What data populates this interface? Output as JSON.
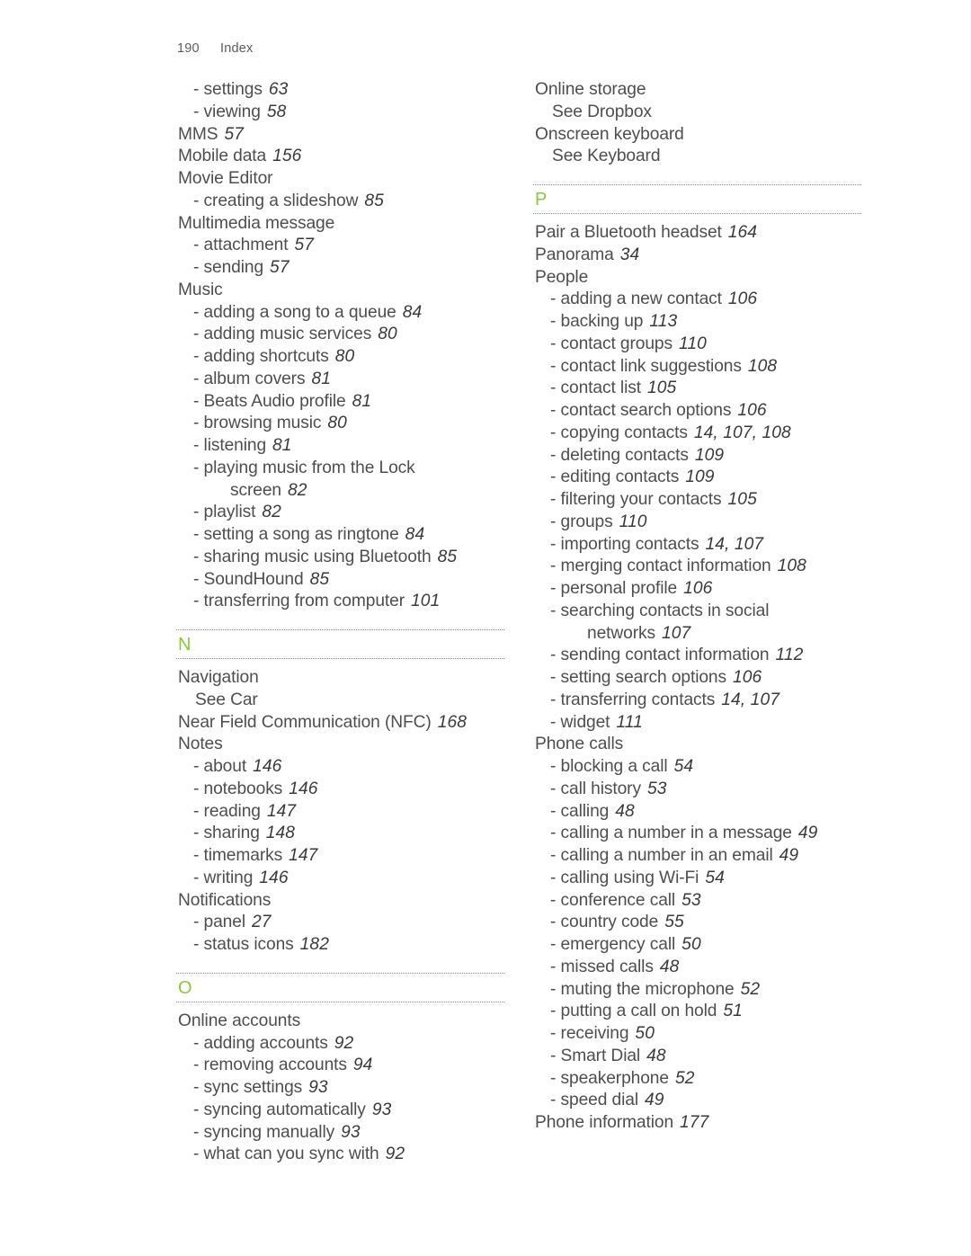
{
  "page": {
    "folio": "190",
    "running_head": "Index",
    "accent_color": "#8CC63E",
    "text_color": "#4E4E4E",
    "rule_color": "#8F8F8F"
  },
  "columns": [
    {
      "name": "left-column",
      "blocks": [
        {
          "type": "entries",
          "entries": [
            {
              "level": 1,
              "dash": "-",
              "term": "settings",
              "pages": "63"
            },
            {
              "level": 1,
              "dash": "-",
              "term": "viewing",
              "pages": "58"
            },
            {
              "level": 0,
              "dash": "",
              "term": "MMS",
              "pages": "57"
            },
            {
              "level": 0,
              "dash": "",
              "term": "Mobile data",
              "pages": "156"
            },
            {
              "level": 0,
              "dash": "",
              "term": "Movie Editor",
              "pages": ""
            },
            {
              "level": 1,
              "dash": "-",
              "term": "creating a slideshow",
              "pages": "85"
            },
            {
              "level": 0,
              "dash": "",
              "term": "Multimedia message",
              "pages": ""
            },
            {
              "level": 1,
              "dash": "-",
              "term": "attachment",
              "pages": "57"
            },
            {
              "level": 1,
              "dash": "-",
              "term": "sending",
              "pages": "57"
            },
            {
              "level": 0,
              "dash": "",
              "term": "Music",
              "pages": ""
            },
            {
              "level": 1,
              "dash": "-",
              "term": "adding a song to a queue",
              "pages": "84"
            },
            {
              "level": 1,
              "dash": "-",
              "term": "adding music services",
              "pages": "80"
            },
            {
              "level": 1,
              "dash": "-",
              "term": "adding shortcuts",
              "pages": "80"
            },
            {
              "level": 1,
              "dash": "-",
              "term": "album covers",
              "pages": "81"
            },
            {
              "level": 1,
              "dash": "-",
              "term": "Beats Audio profile",
              "pages": "81"
            },
            {
              "level": 1,
              "dash": "-",
              "term": "browsing music",
              "pages": "80"
            },
            {
              "level": 1,
              "dash": "-",
              "term": "listening",
              "pages": "81"
            },
            {
              "level": 1,
              "dash": "-",
              "term": "playing music from the Lock",
              "pages": ""
            },
            {
              "level": 2,
              "dash": "",
              "term": "screen",
              "pages": "82"
            },
            {
              "level": 1,
              "dash": "-",
              "term": "playlist",
              "pages": "82"
            },
            {
              "level": 1,
              "dash": "-",
              "term": "setting a song as ringtone",
              "pages": "84"
            },
            {
              "level": 1,
              "dash": "-",
              "term": "sharing music using Bluetooth",
              "pages": "85"
            },
            {
              "level": 1,
              "dash": "-",
              "term": "SoundHound",
              "pages": "85"
            },
            {
              "level": 1,
              "dash": "-",
              "term": "transferring from computer",
              "pages": "101"
            }
          ]
        },
        {
          "type": "section",
          "letter": "N"
        },
        {
          "type": "entries",
          "entries": [
            {
              "level": 0,
              "dash": "",
              "term": "Navigation",
              "pages": ""
            },
            {
              "level": 0,
              "dash": "",
              "term": "See Car",
              "pages": "",
              "xref": true
            },
            {
              "level": 0,
              "dash": "",
              "term": "Near Field Communication (NFC)",
              "pages": "168"
            },
            {
              "level": 0,
              "dash": "",
              "term": "Notes",
              "pages": ""
            },
            {
              "level": 1,
              "dash": "-",
              "term": "about",
              "pages": "146"
            },
            {
              "level": 1,
              "dash": "-",
              "term": "notebooks",
              "pages": "146"
            },
            {
              "level": 1,
              "dash": "-",
              "term": "reading",
              "pages": "147"
            },
            {
              "level": 1,
              "dash": "-",
              "term": "sharing",
              "pages": "148"
            },
            {
              "level": 1,
              "dash": "-",
              "term": "timemarks",
              "pages": "147"
            },
            {
              "level": 1,
              "dash": "-",
              "term": "writing",
              "pages": "146"
            },
            {
              "level": 0,
              "dash": "",
              "term": "Notifications",
              "pages": ""
            },
            {
              "level": 1,
              "dash": "-",
              "term": "panel",
              "pages": "27"
            },
            {
              "level": 1,
              "dash": "-",
              "term": "status icons",
              "pages": "182"
            }
          ]
        },
        {
          "type": "section",
          "letter": "O"
        },
        {
          "type": "entries",
          "entries": [
            {
              "level": 0,
              "dash": "",
              "term": "Online accounts",
              "pages": ""
            },
            {
              "level": 1,
              "dash": "-",
              "term": "adding accounts",
              "pages": "92"
            },
            {
              "level": 1,
              "dash": "-",
              "term": "removing accounts",
              "pages": "94"
            },
            {
              "level": 1,
              "dash": "-",
              "term": "sync settings",
              "pages": "93"
            },
            {
              "level": 1,
              "dash": "-",
              "term": "syncing automatically",
              "pages": "93"
            },
            {
              "level": 1,
              "dash": "-",
              "term": "syncing manually",
              "pages": "93"
            },
            {
              "level": 1,
              "dash": "-",
              "term": "what can you sync with",
              "pages": "92"
            }
          ]
        }
      ]
    },
    {
      "name": "right-column",
      "blocks": [
        {
          "type": "entries",
          "entries": [
            {
              "level": 0,
              "dash": "",
              "term": "Online storage",
              "pages": ""
            },
            {
              "level": 0,
              "dash": "",
              "term": "See Dropbox",
              "pages": "",
              "xref": true
            },
            {
              "level": 0,
              "dash": "",
              "term": "Onscreen keyboard",
              "pages": ""
            },
            {
              "level": 0,
              "dash": "",
              "term": "See Keyboard",
              "pages": "",
              "xref": true
            }
          ]
        },
        {
          "type": "section",
          "letter": "P"
        },
        {
          "type": "entries",
          "entries": [
            {
              "level": 0,
              "dash": "",
              "term": "Pair a Bluetooth headset",
              "pages": "164"
            },
            {
              "level": 0,
              "dash": "",
              "term": "Panorama",
              "pages": "34"
            },
            {
              "level": 0,
              "dash": "",
              "term": "People",
              "pages": ""
            },
            {
              "level": 1,
              "dash": "-",
              "term": "adding a new contact",
              "pages": "106"
            },
            {
              "level": 1,
              "dash": "-",
              "term": "backing up",
              "pages": "113"
            },
            {
              "level": 1,
              "dash": "-",
              "term": "contact groups",
              "pages": "110"
            },
            {
              "level": 1,
              "dash": "-",
              "term": "contact link suggestions",
              "pages": "108"
            },
            {
              "level": 1,
              "dash": "-",
              "term": "contact list",
              "pages": "105"
            },
            {
              "level": 1,
              "dash": "-",
              "term": "contact search options",
              "pages": "106"
            },
            {
              "level": 1,
              "dash": "-",
              "term": "copying contacts",
              "pages": "14, 107, 108"
            },
            {
              "level": 1,
              "dash": "-",
              "term": "deleting contacts",
              "pages": "109"
            },
            {
              "level": 1,
              "dash": "-",
              "term": "editing contacts",
              "pages": "109"
            },
            {
              "level": 1,
              "dash": "-",
              "term": "filtering your contacts",
              "pages": "105"
            },
            {
              "level": 1,
              "dash": "-",
              "term": "groups",
              "pages": "110"
            },
            {
              "level": 1,
              "dash": "-",
              "term": "importing contacts",
              "pages": "14, 107"
            },
            {
              "level": 1,
              "dash": "-",
              "term": "merging contact information",
              "pages": "108"
            },
            {
              "level": 1,
              "dash": "-",
              "term": "personal profile",
              "pages": "106"
            },
            {
              "level": 1,
              "dash": "-",
              "term": "searching contacts in social",
              "pages": ""
            },
            {
              "level": 2,
              "dash": "",
              "term": "networks",
              "pages": "107"
            },
            {
              "level": 1,
              "dash": "-",
              "term": "sending contact information",
              "pages": "112"
            },
            {
              "level": 1,
              "dash": "-",
              "term": "setting search options",
              "pages": "106"
            },
            {
              "level": 1,
              "dash": "-",
              "term": "transferring contacts",
              "pages": "14, 107"
            },
            {
              "level": 1,
              "dash": "-",
              "term": "widget",
              "pages": "111"
            },
            {
              "level": 0,
              "dash": "",
              "term": "Phone calls",
              "pages": ""
            },
            {
              "level": 1,
              "dash": "-",
              "term": "blocking a call",
              "pages": "54"
            },
            {
              "level": 1,
              "dash": "-",
              "term": "call history",
              "pages": "53"
            },
            {
              "level": 1,
              "dash": "-",
              "term": "calling",
              "pages": "48"
            },
            {
              "level": 1,
              "dash": "-",
              "term": "calling a number in a message",
              "pages": "49"
            },
            {
              "level": 1,
              "dash": "-",
              "term": "calling a number in an email",
              "pages": "49"
            },
            {
              "level": 1,
              "dash": "-",
              "term": "calling using Wi-Fi",
              "pages": "54"
            },
            {
              "level": 1,
              "dash": "-",
              "term": "conference call",
              "pages": "53"
            },
            {
              "level": 1,
              "dash": "-",
              "term": "country code",
              "pages": "55"
            },
            {
              "level": 1,
              "dash": "-",
              "term": "emergency call",
              "pages": "50"
            },
            {
              "level": 1,
              "dash": "-",
              "term": "missed calls",
              "pages": "48"
            },
            {
              "level": 1,
              "dash": "-",
              "term": "muting the microphone",
              "pages": "52"
            },
            {
              "level": 1,
              "dash": "-",
              "term": "putting a call on hold",
              "pages": "51"
            },
            {
              "level": 1,
              "dash": "-",
              "term": "receiving",
              "pages": "50"
            },
            {
              "level": 1,
              "dash": "-",
              "term": "Smart Dial",
              "pages": "48"
            },
            {
              "level": 1,
              "dash": "-",
              "term": "speakerphone",
              "pages": "52"
            },
            {
              "level": 1,
              "dash": "-",
              "term": "speed dial",
              "pages": "49"
            },
            {
              "level": 0,
              "dash": "",
              "term": "Phone information",
              "pages": "177"
            }
          ]
        }
      ]
    }
  ]
}
